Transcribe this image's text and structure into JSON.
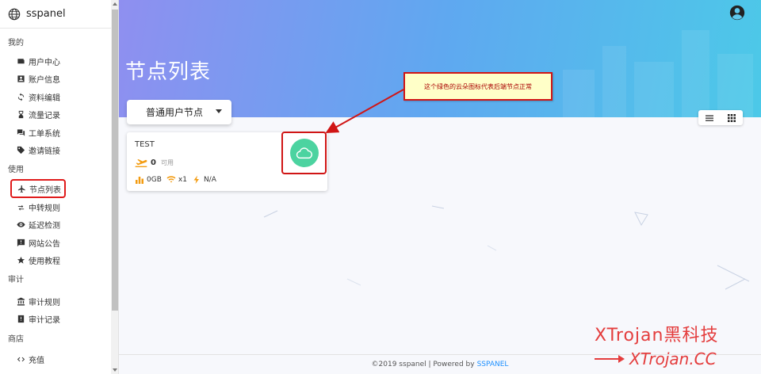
{
  "brand": {
    "name": "sspanel",
    "icon": "globe-icon"
  },
  "sidebar": {
    "sections": [
      {
        "label": "我的",
        "items": [
          {
            "label": "用户中心",
            "icon": "wallet-icon"
          },
          {
            "label": "账户信息",
            "icon": "account-box-icon"
          },
          {
            "label": "资料编辑",
            "icon": "sync-icon"
          },
          {
            "label": "流量记录",
            "icon": "hourglass-icon"
          },
          {
            "label": "工单系统",
            "icon": "forum-icon"
          },
          {
            "label": "邀请链接",
            "icon": "tag-icon"
          }
        ]
      },
      {
        "label": "使用",
        "items": [
          {
            "label": "节点列表",
            "icon": "airplane-icon"
          },
          {
            "label": "中转规则",
            "icon": "transfer-icon"
          },
          {
            "label": "延迟检测",
            "icon": "eye-icon"
          },
          {
            "label": "网站公告",
            "icon": "announcement-icon"
          },
          {
            "label": "使用教程",
            "icon": "star-icon"
          }
        ]
      },
      {
        "label": "审计",
        "items": [
          {
            "label": "审计规则",
            "icon": "bank-icon"
          },
          {
            "label": "审计记录",
            "icon": "report-icon"
          }
        ]
      },
      {
        "label": "商店",
        "items": [
          {
            "label": "充值",
            "icon": "code-icon"
          }
        ]
      }
    ]
  },
  "header": {
    "title": "节点列表"
  },
  "filter": {
    "selected": "普通用户节点"
  },
  "node": {
    "name": "TEST",
    "online": "0",
    "available_label": "可用",
    "traffic": "0GB",
    "rate": "x1",
    "speed": "N/A",
    "status_color": "#4cd3a0"
  },
  "annotation": {
    "text": "这个绿色的云朵图标代表后端节点正常"
  },
  "footer": {
    "text": "©2019 sspanel | Powered by",
    "link": "SSPANEL"
  },
  "watermark": {
    "line1": "XTrojan黑科技",
    "line2": "XTrojan.CC"
  },
  "colors": {
    "accent_orange": "#f39c12",
    "highlight_red": "#d01515"
  }
}
